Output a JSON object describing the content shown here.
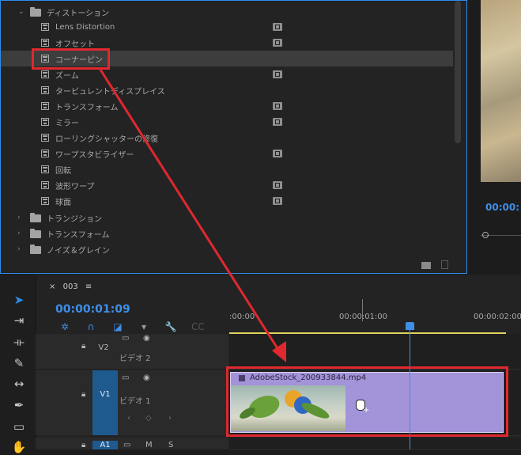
{
  "effects": {
    "folder_open": "ディストーション",
    "items": [
      {
        "label": "Lens Distortion",
        "accelerated": true
      },
      {
        "label": "オフセット",
        "accelerated": true
      },
      {
        "label": "コーナーピン",
        "accelerated": false
      },
      {
        "label": "ズーム",
        "accelerated": true
      },
      {
        "label": "タービュレントディスプレイス",
        "accelerated": false
      },
      {
        "label": "トランスフォーム",
        "accelerated": true
      },
      {
        "label": "ミラー",
        "accelerated": true
      },
      {
        "label": "ローリングシャッターの修復",
        "accelerated": false
      },
      {
        "label": "ワープスタビライザー",
        "accelerated": true
      },
      {
        "label": "回転",
        "accelerated": false
      },
      {
        "label": "波形ワープ",
        "accelerated": true
      },
      {
        "label": "球面",
        "accelerated": true
      }
    ],
    "collapsed_folders": [
      "トランジション",
      "トランスフォーム",
      "ノイズ＆グレイン"
    ]
  },
  "program_monitor": {
    "timecode": "00:00:"
  },
  "timeline": {
    "sequence_name": "003",
    "timecode": "00:00:01:09",
    "ruler_labels": [
      ":00:00",
      "00:00:01:00",
      "00:00:02:00"
    ],
    "tracks": [
      {
        "id": "V2",
        "name": "ビデオ 2"
      },
      {
        "id": "V1",
        "name": "ビデオ 1"
      },
      {
        "id": "A1",
        "name": ""
      }
    ],
    "audio_buttons": {
      "mute": "M",
      "solo": "S"
    },
    "clip_name": "AdobeStock_200933844.mp4"
  },
  "colors": {
    "accent": "#2d8ceb",
    "clip": "#a393d9",
    "annotation": "#e0282e",
    "work_area": "#e0d35b"
  }
}
